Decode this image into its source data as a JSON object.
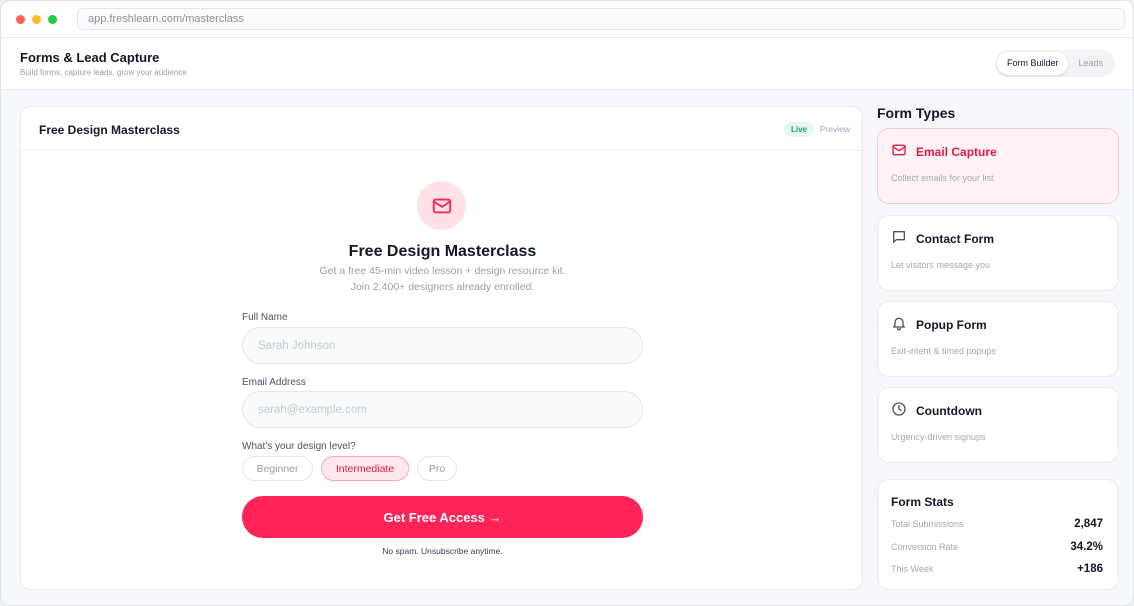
{
  "browser": {
    "url": "app.freshlearn.com/masterclass"
  },
  "header": {
    "title": "Forms & Lead Capture",
    "subtitle": "Build forms, capture leads, grow your audience",
    "tabs": [
      {
        "label": "Form Builder",
        "active": true
      },
      {
        "label": "Leads",
        "active": false
      }
    ]
  },
  "card": {
    "title": "Free Design Masterclass",
    "status_badge": "Live",
    "preview_label": "Preview"
  },
  "form": {
    "icon": "mail-icon",
    "title": "Free Design Masterclass",
    "description_line1": "Get a free 45-min video lesson + design resource kit.",
    "description_line2": "Join 2,400+ designers already enrolled.",
    "fields": {
      "name": {
        "label": "Full Name",
        "placeholder": "Sarah Johnson",
        "value": ""
      },
      "email": {
        "label": "Email Address",
        "placeholder": "sarah@example.com",
        "value": ""
      }
    },
    "level": {
      "label": "What's your design level?",
      "options": [
        "Beginner",
        "Intermediate",
        "Pro"
      ],
      "selected": "Intermediate"
    },
    "submit_label": "Get Free Access →",
    "disclaimer": "No spam. Unsubscribe anytime."
  },
  "sidebar": {
    "title": "Form Types",
    "types": [
      {
        "name": "Email Capture",
        "desc": "Collect emails for your list",
        "icon": "mail-icon",
        "active": true
      },
      {
        "name": "Contact Form",
        "desc": "Let visitors message you",
        "icon": "message-icon",
        "active": false
      },
      {
        "name": "Popup Form",
        "desc": "Exit-intent & timed popups",
        "icon": "bell-icon",
        "active": false
      },
      {
        "name": "Countdown",
        "desc": "Urgency-driven signups",
        "icon": "clock-icon",
        "active": false
      }
    ],
    "stats": {
      "title": "Form Stats",
      "rows": [
        {
          "label": "Total Submissions",
          "value": "2,847"
        },
        {
          "label": "Conversion Rate",
          "value": "34.2%"
        },
        {
          "label": "This Week",
          "value": "+186"
        }
      ]
    }
  },
  "colors": {
    "accent": "#ff2357",
    "accent_text": "#e11d48",
    "live_green": "#1fa463"
  }
}
